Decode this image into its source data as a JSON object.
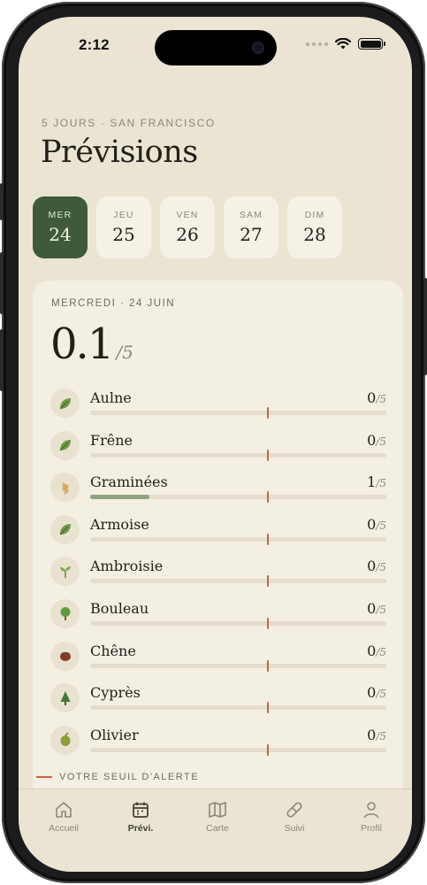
{
  "status": {
    "time": "2:12"
  },
  "header": {
    "eyebrow": "5 JOURS · SAN FRANCISCO",
    "title": "Prévisions"
  },
  "days": [
    {
      "dow": "MER",
      "num": "24",
      "active": true
    },
    {
      "dow": "JEU",
      "num": "25",
      "active": false
    },
    {
      "dow": "VEN",
      "num": "26",
      "active": false
    },
    {
      "dow": "SAM",
      "num": "27",
      "active": false
    },
    {
      "dow": "DIM",
      "num": "28",
      "active": false
    }
  ],
  "card": {
    "date": "MERCREDI · 24 JUIN",
    "score": "0.1",
    "score_max": "/5",
    "threshold": 0.6,
    "pollens": [
      {
        "name": "Aulne",
        "value": "0",
        "max": "/5",
        "level": 0,
        "icon": "leaf-icon"
      },
      {
        "name": "Frêne",
        "value": "0",
        "max": "/5",
        "level": 0,
        "icon": "leaf-icon"
      },
      {
        "name": "Graminées",
        "value": "1",
        "max": "/5",
        "level": 0.2,
        "icon": "wheat-icon"
      },
      {
        "name": "Armoise",
        "value": "0",
        "max": "/5",
        "level": 0,
        "icon": "leaf-icon"
      },
      {
        "name": "Ambroisie",
        "value": "0",
        "max": "/5",
        "level": 0,
        "icon": "sprout-icon"
      },
      {
        "name": "Bouleau",
        "value": "0",
        "max": "/5",
        "level": 0,
        "icon": "tree-icon"
      },
      {
        "name": "Chêne",
        "value": "0",
        "max": "/5",
        "level": 0,
        "icon": "acorn-icon"
      },
      {
        "name": "Cyprès",
        "value": "0",
        "max": "/5",
        "level": 0,
        "icon": "conifer-icon"
      },
      {
        "name": "Olivier",
        "value": "0",
        "max": "/5",
        "level": 0,
        "icon": "olive-icon"
      }
    ],
    "legend": "VOTRE SEUIL D'ALERTE"
  },
  "tabs": [
    {
      "label": "Accueil",
      "icon": "home-icon",
      "active": false
    },
    {
      "label": "Prévi.",
      "icon": "calendar-icon",
      "active": true
    },
    {
      "label": "Carte",
      "icon": "map-icon",
      "active": false
    },
    {
      "label": "Suivi",
      "icon": "pill-icon",
      "active": false
    },
    {
      "label": "Profil",
      "icon": "user-icon",
      "active": false
    }
  ],
  "colors": {
    "background": "#ebe4d3",
    "card": "#f4efe3",
    "accent": "#3f5a39",
    "threshold": "#c8663f",
    "level_fill": "#8fa37f"
  }
}
